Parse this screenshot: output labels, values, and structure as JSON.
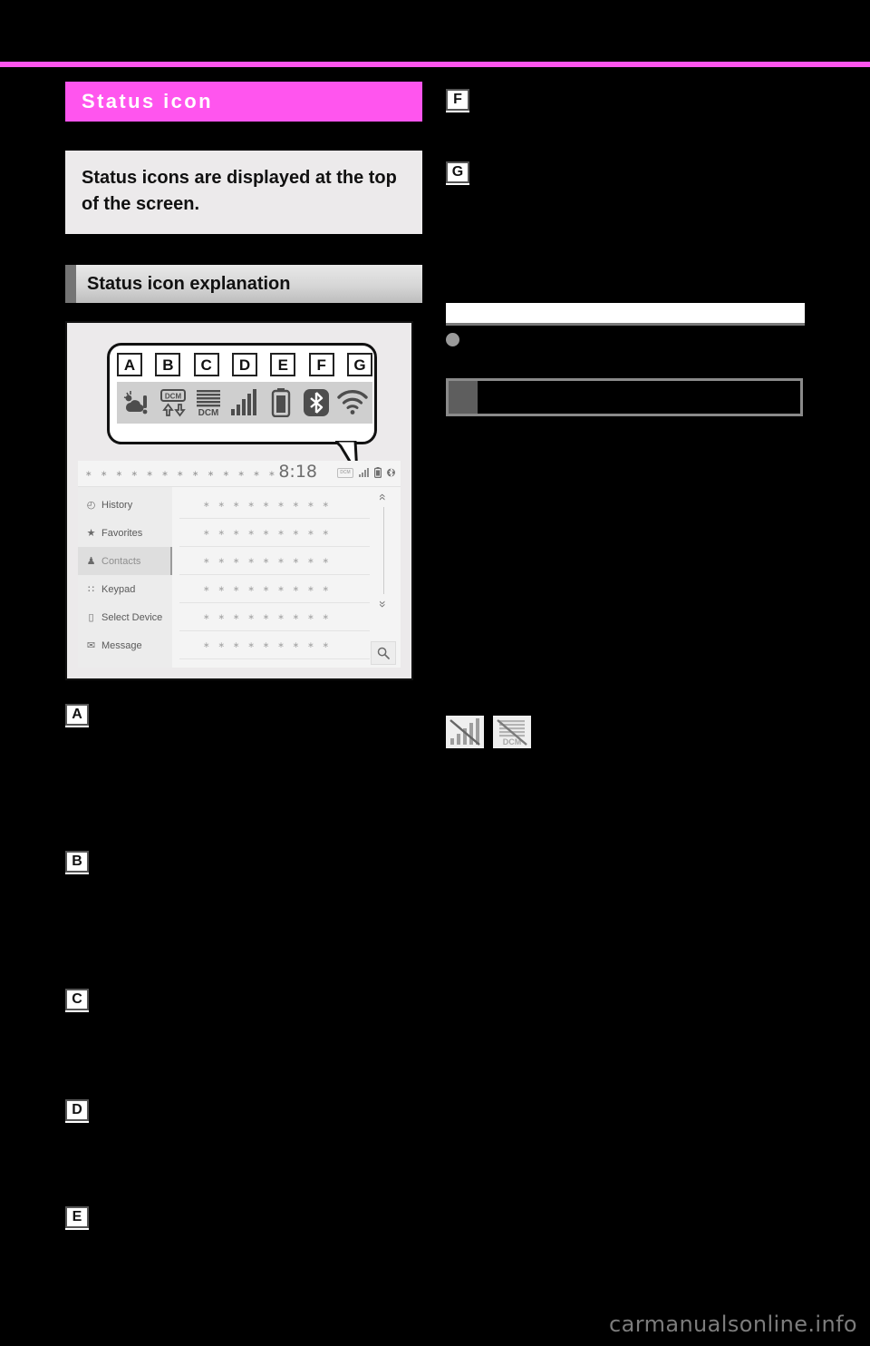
{
  "page": {
    "background_color": "#000000",
    "accent_color": "#ff55ee",
    "watermark": "carmanualsonline.info"
  },
  "chapter": {
    "title": "Status icon"
  },
  "intro": {
    "text": "Status icons are displayed at the top of the screen."
  },
  "section": {
    "heading": "Status icon explanation"
  },
  "figure": {
    "callout": {
      "letters": [
        "A",
        "B",
        "C",
        "D",
        "E",
        "F",
        "G"
      ],
      "icons": [
        {
          "name": "weather-alert-icon",
          "glyph": "☀"
        },
        {
          "name": "dcm-transfer-icon",
          "label": "DCM"
        },
        {
          "name": "dcm-signal-icon",
          "label": "DCM"
        },
        {
          "name": "signal-bars-icon",
          "glyph": "bars"
        },
        {
          "name": "battery-icon",
          "glyph": "battery"
        },
        {
          "name": "bluetooth-icon",
          "glyph": "bt"
        },
        {
          "name": "wifi-icon",
          "glyph": "wifi"
        }
      ]
    },
    "screen": {
      "title_dots": "∗ ∗ ∗ ∗ ∗ ∗ ∗ ∗ ∗ ∗ ∗ ∗ ∗",
      "clock": "8:18",
      "status_mini_label": "DCM",
      "menu": [
        {
          "icon": "clock-icon",
          "glyph": "◴",
          "label": "History",
          "selected": false
        },
        {
          "icon": "star-icon",
          "glyph": "★",
          "label": "Favorites",
          "selected": false
        },
        {
          "icon": "contacts-icon",
          "glyph": "♟",
          "label": "Contacts",
          "selected": true
        },
        {
          "icon": "keypad-icon",
          "glyph": "∷",
          "label": "Keypad",
          "selected": false
        },
        {
          "icon": "select-device-icon",
          "glyph": "▯",
          "label": "Select Device",
          "selected": false
        },
        {
          "icon": "message-icon",
          "glyph": "✉",
          "label": "Message",
          "selected": false
        }
      ],
      "list_rows": [
        "∗ ∗ ∗ ∗ ∗ ∗ ∗ ∗ ∗",
        "∗ ∗ ∗ ∗ ∗ ∗ ∗ ∗ ∗",
        "∗ ∗ ∗ ∗ ∗ ∗ ∗ ∗ ∗",
        "∗ ∗ ∗ ∗ ∗ ∗ ∗ ∗ ∗",
        "∗ ∗ ∗ ∗ ∗ ∗ ∗ ∗ ∗",
        "∗ ∗ ∗ ∗ ∗ ∗ ∗ ∗ ∗"
      ],
      "scroll_up": "«",
      "scroll_down": "»",
      "search_icon": "⚲"
    }
  },
  "entries_left": [
    {
      "marker": "A",
      "text": ""
    },
    {
      "marker": "B",
      "text": ""
    },
    {
      "marker": "C",
      "text": ""
    },
    {
      "marker": "D",
      "text": ""
    },
    {
      "marker": "E",
      "text": ""
    }
  ],
  "entries_right": [
    {
      "marker": "F",
      "text": ""
    },
    {
      "marker": "G",
      "text": ""
    }
  ],
  "note": {
    "heading": "",
    "bullet_text": ""
  },
  "sub_section": {
    "heading": ""
  },
  "crossed_icons": [
    {
      "name": "no-signal-icon",
      "label": ""
    },
    {
      "name": "no-dcm-icon",
      "label": "DCM"
    }
  ]
}
